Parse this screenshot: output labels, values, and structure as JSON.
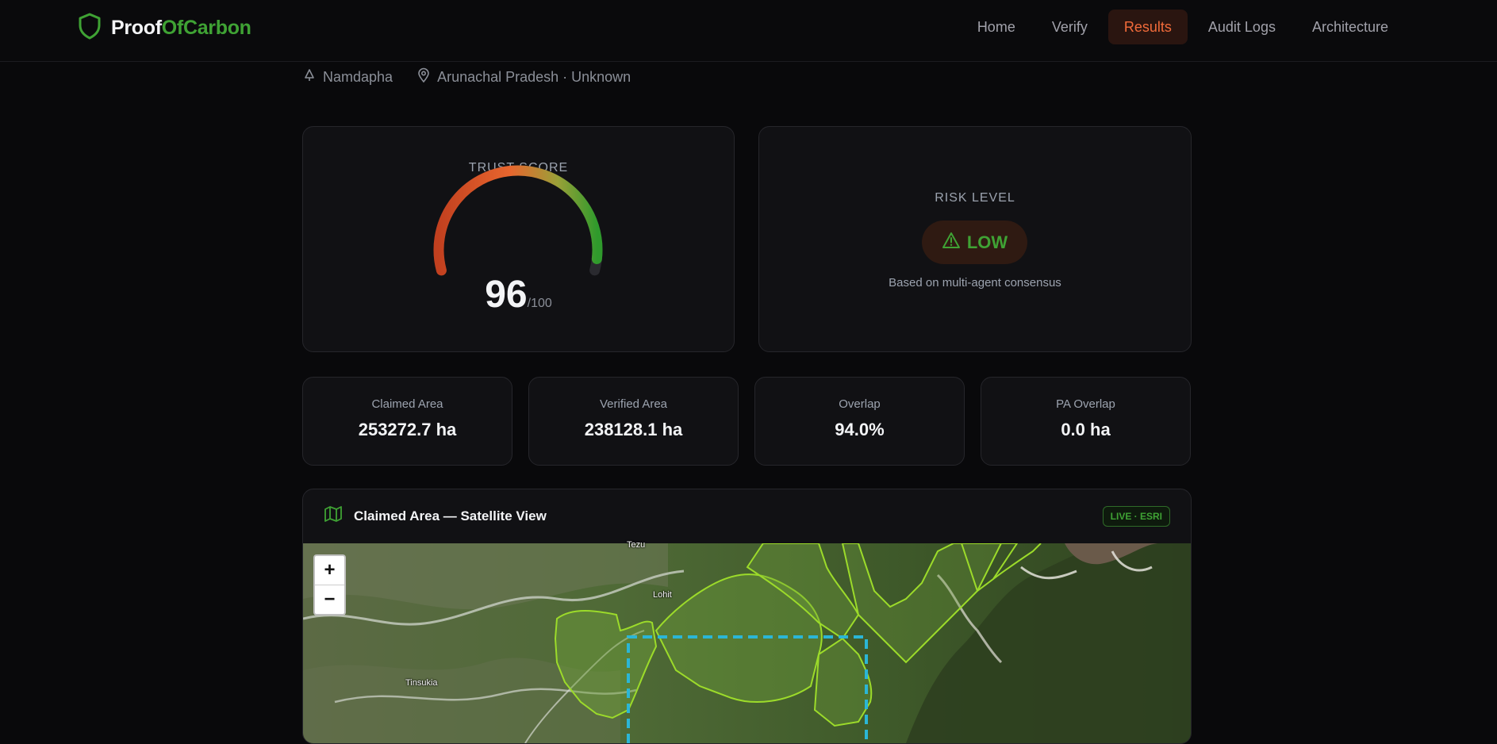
{
  "brand": {
    "name_part1": "Proof",
    "name_part2": "OfCarbon"
  },
  "nav": {
    "links": [
      {
        "label": "Home"
      },
      {
        "label": "Verify"
      },
      {
        "label": "Results"
      },
      {
        "label": "Audit Logs"
      },
      {
        "label": "Architecture"
      }
    ],
    "active": "Results"
  },
  "location": {
    "site": "Namdapha",
    "region": "Arunachal Pradesh · Unknown"
  },
  "trust": {
    "title": "TRUST SCORE",
    "score": "96",
    "max": "/100",
    "fraction": 0.96
  },
  "risk": {
    "title": "RISK LEVEL",
    "level": "LOW",
    "note": "Based on multi-agent consensus"
  },
  "stats": [
    {
      "label": "Claimed Area",
      "value": "253272.7 ha"
    },
    {
      "label": "Verified Area",
      "value": "238128.1 ha"
    },
    {
      "label": "Overlap",
      "value": "94.0%"
    },
    {
      "label": "PA Overlap",
      "value": "0.0 ha"
    }
  ],
  "map": {
    "title": "Claimed Area — Satellite View",
    "badge": "LIVE · ESRI",
    "zoom_in": "+",
    "zoom_out": "−",
    "places": {
      "tezu": "Tezu",
      "lohit": "Lohit",
      "tinsukia": "Tinsukia"
    }
  },
  "colors": {
    "accent_green": "#3fa234",
    "accent_orange": "#f26b3a",
    "claim_outline": "#2bb6d6",
    "forest_outline": "#9cdb2a"
  }
}
